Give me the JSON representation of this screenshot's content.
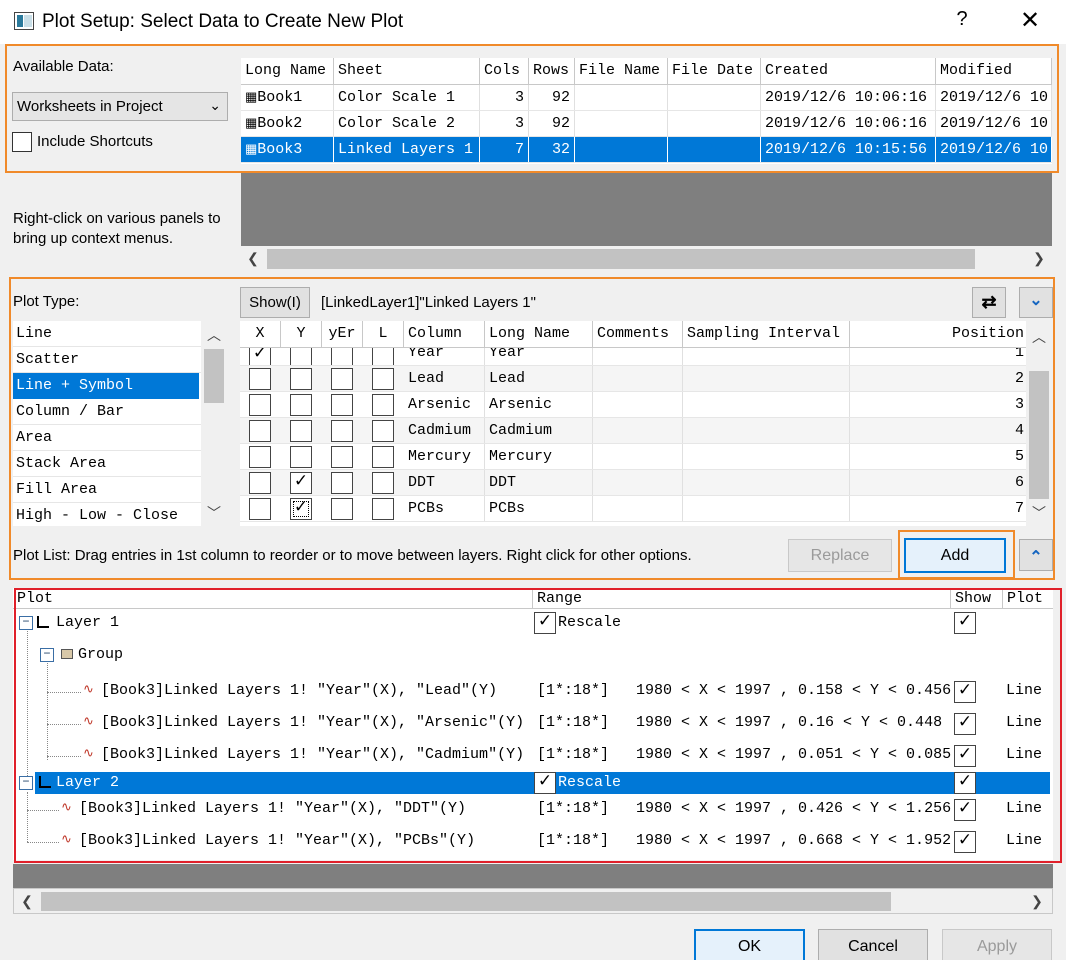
{
  "window": {
    "title": "Plot Setup: Select Data to Create New Plot",
    "help": "?",
    "close": "✕"
  },
  "available": {
    "label": "Available Data:",
    "combo_value": "Worksheets in Project",
    "include_shortcuts": "Include Shortcuts",
    "hint": "Right-click on various panels to bring up context menus.",
    "columns": [
      "Long Name",
      "Sheet",
      "Cols",
      "Rows",
      "File Name",
      "File Date",
      "Created",
      "Modified"
    ],
    "rows": [
      {
        "name": "Book1",
        "sheet": "Color Scale 1",
        "cols": "3",
        "rows": "92",
        "file_name": "",
        "file_date": "",
        "created": "2019/12/6 10:06:16",
        "modified": "2019/12/6 10:"
      },
      {
        "name": "Book2",
        "sheet": "Color Scale 2",
        "cols": "3",
        "rows": "92",
        "file_name": "",
        "file_date": "",
        "created": "2019/12/6 10:06:16",
        "modified": "2019/12/6 10:"
      },
      {
        "name": "Book3",
        "sheet": "Linked Layers 1",
        "cols": "7",
        "rows": "32",
        "file_name": "",
        "file_date": "",
        "created": "2019/12/6 10:15:56",
        "modified": "2019/12/6 10:"
      }
    ]
  },
  "plot_type": {
    "label": "Plot Type:",
    "items": [
      "Line",
      "Scatter",
      "Line + Symbol",
      "Column / Bar",
      "Area",
      "Stack Area",
      "Fill Area",
      "High - Low - Close"
    ],
    "selected": "Line + Symbol"
  },
  "columns_panel": {
    "show_button": "Show(I)",
    "path": "[LinkedLayer1]\"Linked Layers 1\"",
    "swap_icon": "⇄",
    "expand_icon": "⌄",
    "headers": [
      "X",
      "Y",
      "yEr",
      "L",
      "Column",
      "Long Name",
      "Comments",
      "Sampling Interval",
      "Position"
    ],
    "rows": [
      {
        "x": "✓",
        "y": "",
        "column": "Year",
        "long_name": "Year",
        "position": "1"
      },
      {
        "x": "",
        "y": "",
        "column": "Lead",
        "long_name": "Lead",
        "position": "2"
      },
      {
        "x": "",
        "y": "",
        "column": "Arsenic",
        "long_name": "Arsenic",
        "position": "3"
      },
      {
        "x": "",
        "y": "",
        "column": "Cadmium",
        "long_name": "Cadmium",
        "position": "4"
      },
      {
        "x": "",
        "y": "",
        "column": "Mercury",
        "long_name": "Mercury",
        "position": "5"
      },
      {
        "x": "",
        "y": "✓",
        "column": "DDT",
        "long_name": "DDT",
        "position": "6"
      },
      {
        "x": "",
        "y": "✓",
        "column": "PCBs",
        "long_name": "PCBs",
        "position": "7"
      }
    ]
  },
  "plot_list": {
    "hint": "Plot List: Drag entries in 1st column to reorder or to move between layers. Right click for other options.",
    "replace": "Replace",
    "add": "Add",
    "collapse_icon": "⌃",
    "headers": [
      "Plot",
      "Range",
      "Show",
      "Plot"
    ],
    "layer1": {
      "label": "Layer 1",
      "range": "Rescale",
      "show": "✓"
    },
    "group": {
      "label": "Group"
    },
    "layer1_items": [
      {
        "label": "[Book3]Linked Layers 1! \"Year\"(X), \"Lead\"(Y)",
        "range": "[1*:18*]   1980 < X < 1997 , 0.158 < Y < 0.456",
        "show": "✓",
        "type": "Line"
      },
      {
        "label": "[Book3]Linked Layers 1! \"Year\"(X), \"Arsenic\"(Y)",
        "range": "[1*:18*]   1980 < X < 1997 , 0.16 < Y < 0.448",
        "show": "✓",
        "type": "Line"
      },
      {
        "label": "[Book3]Linked Layers 1! \"Year\"(X), \"Cadmium\"(Y)",
        "range": "[1*:18*]   1980 < X < 1997 , 0.051 < Y < 0.085",
        "show": "✓",
        "type": "Line"
      }
    ],
    "layer2": {
      "label": "Layer 2",
      "range": "Rescale",
      "show": "✓"
    },
    "layer2_items": [
      {
        "label": "[Book3]Linked Layers 1! \"Year\"(X), \"DDT\"(Y)",
        "range": "[1*:18*]   1980 < X < 1997 , 0.426 < Y < 1.256",
        "show": "✓",
        "type": "Line"
      },
      {
        "label": "[Book3]Linked Layers 1! \"Year\"(X), \"PCBs\"(Y)",
        "range": "[1*:18*]   1980 < X < 1997 , 0.668 < Y < 1.952",
        "show": "✓",
        "type": "Line"
      }
    ]
  },
  "footer": {
    "ok": "OK",
    "cancel": "Cancel",
    "apply": "Apply"
  },
  "colors": {
    "accent": "#0078d7",
    "highlight_orange": "#f08a2a",
    "highlight_red": "#e0202a"
  }
}
